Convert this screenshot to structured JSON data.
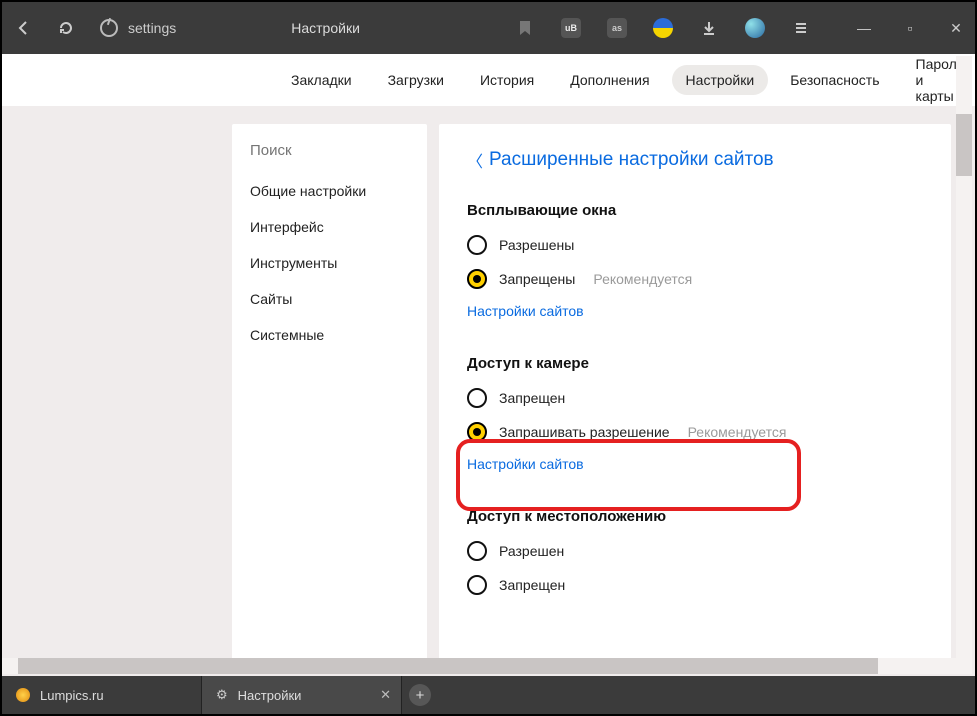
{
  "titlebar": {
    "address": "settings",
    "page_title": "Настройки"
  },
  "tabs_nav": {
    "items": [
      "Закладки",
      "Загрузки",
      "История",
      "Дополнения",
      "Настройки",
      "Безопасность",
      "Пароли и карты"
    ],
    "active_index": 4
  },
  "sidebar": {
    "search_placeholder": "Поиск",
    "items": [
      "Общие настройки",
      "Интерфейс",
      "Инструменты",
      "Сайты",
      "Системные"
    ]
  },
  "main": {
    "breadcrumb": "Расширенные настройки сайтов",
    "sections": [
      {
        "title": "Всплывающие окна",
        "options": [
          {
            "label": "Разрешены",
            "checked": false,
            "recommended": false
          },
          {
            "label": "Запрещены",
            "checked": true,
            "recommended": true
          }
        ],
        "link": "Настройки сайтов"
      },
      {
        "title": "Доступ к камере",
        "options": [
          {
            "label": "Запрещен",
            "checked": false,
            "recommended": false
          },
          {
            "label": "Запрашивать разрешение",
            "checked": true,
            "recommended": true
          }
        ],
        "link": "Настройки сайтов"
      },
      {
        "title": "Доступ к местоположению",
        "options": [
          {
            "label": "Разрешен",
            "checked": false,
            "recommended": false
          },
          {
            "label": "Запрещен",
            "checked": false,
            "recommended": false
          }
        ],
        "link": null
      }
    ],
    "recommended_label": "Рекомендуется"
  },
  "browser_tabs": [
    {
      "title": "Lumpics.ru",
      "icon": "lump",
      "closable": false
    },
    {
      "title": "Настройки",
      "icon": "gear",
      "closable": true
    }
  ]
}
